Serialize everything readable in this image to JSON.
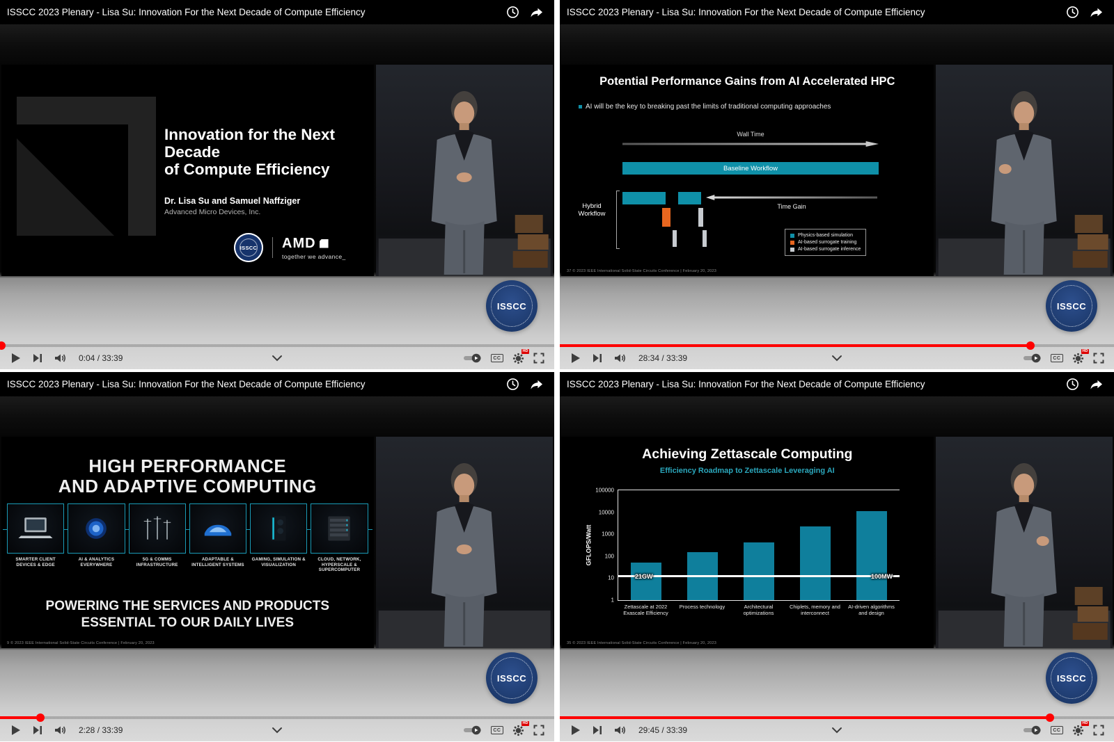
{
  "colors": {
    "accent_teal": "#0f90a8",
    "accent_orange": "#e8661f",
    "accent_gray": "#c7cbd0",
    "progress_red": "#ff0000",
    "isscc_navy": "#1d3a6d",
    "chart_bar_teal": "#0f7f9c",
    "subtitle_teal": "#2ba7bc"
  },
  "chrome": {
    "cc_label": "CC",
    "hd_badge": "HD"
  },
  "stage": {
    "logo_text": "ISSCC"
  },
  "players": [
    {
      "title": "ISSCC 2023 Plenary - Lisa Su: Innovation For the Next Decade of Compute Efficiency",
      "time": "0:04 / 33:39",
      "progress": "0.3%",
      "slide": {
        "heading1": "Innovation for the Next Decade",
        "heading2": "of Compute Efficiency",
        "authors": "Dr. Lisa Su and Samuel Naffziger",
        "company": "Advanced Micro Devices, Inc.",
        "badge": "ISSCC",
        "amd": "AMD",
        "tagline": "together we advance_"
      }
    },
    {
      "title": "ISSCC 2023 Plenary - Lisa Su: Innovation For the Next Decade of Compute Efficiency",
      "time": "28:34 / 33:39",
      "progress": "84.9%",
      "slide": {
        "title": "Potential Performance Gains from AI Accelerated HPC",
        "bullet": "AI will be the key to breaking past the limits of traditional computing approaches",
        "wall_time": "Wall Time",
        "baseline": "Baseline Workflow",
        "hybrid": "Hybrid Workflow",
        "time_gain": "Time Gain",
        "legend1": "Physics-based simulation",
        "legend2": "AI-based surrogate training",
        "legend3": "AI-based surrogate inference",
        "footer": "37      © 2023 IEEE International Solid-State Circuits Conference  |  February 20, 2023"
      }
    },
    {
      "title": "ISSCC 2023 Plenary - Lisa Su: Innovation For the Next Decade of Compute Efficiency",
      "time": "2:28 / 33:39",
      "progress": "7.3%",
      "slide": {
        "title1": "HIGH PERFORMANCE",
        "title2": "AND ADAPTIVE COMPUTING",
        "tile1": "SMARTER CLIENT DEVICES & EDGE",
        "tile2": "AI & ANALYTICS EVERYWHERE",
        "tile3": "5G & COMMS INFRASTRUCTURE",
        "tile4": "ADAPTABLE & INTELLIGENT SYSTEMS",
        "tile5": "GAMING, SIMULATION & VISUALIZATION",
        "tile6": "CLOUD, NETWORK, HYPERSCALE & SUPERCOMPUTER",
        "tagline1": "POWERING THE SERVICES AND PRODUCTS",
        "tagline2": "ESSENTIAL TO OUR DAILY LIVES",
        "footer": "9      © 2023 IEEE International Solid-State Circuits Conference  |  February 20, 2023"
      }
    },
    {
      "title": "ISSCC 2023 Plenary - Lisa Su: Innovation For the Next Decade of Compute Efficiency",
      "time": "29:45 / 33:39",
      "progress": "88.4%",
      "slide": {
        "title": "Achieving Zettascale Computing",
        "subtitle": "Efficiency Roadmap to Zettascale Leveraging AI",
        "ylabel": "GFLOPS/Watt",
        "line_left": "21GW",
        "line_right": "100MW",
        "footer": "35      © 2023 IEEE International Solid-State Circuits Conference  |  February 20, 2023",
        "chart_data": {
          "type": "bar",
          "title": "Efficiency Roadmap to Zettascale Leveraging AI",
          "ylabel": "GFLOPS/Watt",
          "y_scale": "log",
          "ylim": [
            1,
            100000
          ],
          "yticks": [
            1,
            10,
            100,
            1000,
            10000,
            100000
          ],
          "categories": [
            "Zettascale at 2022 Exascale Efficiency",
            "Process technology",
            "Architectural optimizations",
            "Chiplets, memory and interconnect",
            "AI-driven algorithms and design"
          ],
          "values": [
            50,
            150,
            420,
            2200,
            11000
          ],
          "power_line": {
            "value": 11,
            "left_label": "21GW",
            "right_label": "100MW"
          },
          "grid": "top and baseline only",
          "legend": "none"
        }
      }
    }
  ]
}
